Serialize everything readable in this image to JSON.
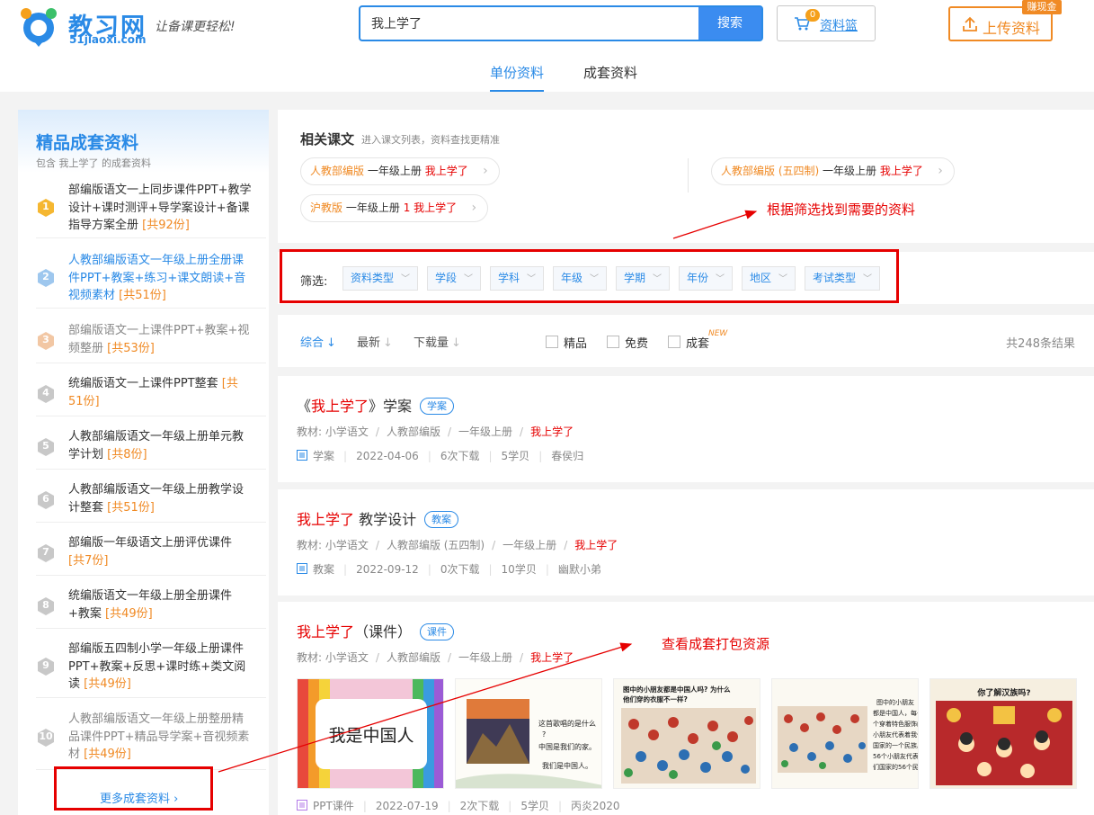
{
  "header": {
    "logo_name": "教习网",
    "logo_domain": "51jiaoxi.com",
    "slogan": "让备课更轻松!",
    "search_value": "我上学了",
    "search_button": "搜索",
    "basket_label": "资料篮",
    "basket_count": "0",
    "upload_label": "上传资料",
    "reward_badge": "赚现金",
    "tabs": [
      "单份资料",
      "成套资料"
    ]
  },
  "sidebar": {
    "title": "精品成套资料",
    "subtitle": "包含 我上学了 的成套资料",
    "items": [
      {
        "num": "1",
        "text": "部编版语文一上同步课件PPT+教学设计+课时测评+导学案设计+备课指导方案全册",
        "count": "[共92份]"
      },
      {
        "num": "2",
        "text": "人教部编版语文一年级上册全册课件PPT+教案+练习+课文朗读+音视频素材",
        "count": "[共51份]"
      },
      {
        "num": "3",
        "text": "部编版语文一上课件PPT+教案+视频整册",
        "count": "[共53份]"
      },
      {
        "num": "4",
        "text": "统编版语文一上课件PPT整套",
        "count": "[共51份]"
      },
      {
        "num": "5",
        "text": "人教部编版语文一年级上册单元教学计划",
        "count": "[共8份]"
      },
      {
        "num": "6",
        "text": "人教部编版语文一年级上册教学设计整套",
        "count": "[共51份]"
      },
      {
        "num": "7",
        "text": "部编版一年级语文上册评优课件",
        "count": "[共7份]"
      },
      {
        "num": "8",
        "text": "统编版语文一年级上册全册课件+教案",
        "count": "[共49份]"
      },
      {
        "num": "9",
        "text": "部编版五四制小学一年级上册课件PPT+教案+反思+课时练+类文阅读",
        "count": "[共49份]"
      },
      {
        "num": "10",
        "text": "人教部编版语文一年级上册整册精品课件PPT+精品导学案+音视频素材",
        "count": "[共49份]"
      }
    ],
    "more_label": "更多成套资料 ›"
  },
  "related": {
    "title": "相关课文",
    "subtitle": "进入课文列表，资料查找更精准",
    "chips": [
      {
        "edition": "人教部编版",
        "grade": "一年级上册",
        "lesson": "我上学了"
      },
      {
        "edition": "人教部编版 (五四制)",
        "grade": "一年级上册",
        "lesson": "我上学了"
      },
      {
        "edition": "沪教版",
        "grade": "一年级上册",
        "lesson": "1 我上学了"
      }
    ],
    "annotation": "根据筛选找到需要的资料"
  },
  "filter": {
    "label": "筛选:",
    "options": [
      "资料类型",
      "学段",
      "学科",
      "年级",
      "学期",
      "年份",
      "地区",
      "考试类型"
    ]
  },
  "sortbar": {
    "sorts": [
      "综合",
      "最新",
      "下载量"
    ],
    "checks": [
      "精品",
      "免费",
      "成套"
    ],
    "new_badge": "NEW",
    "total": "共248条结果"
  },
  "results": [
    {
      "title_pre": "《",
      "title_red": "我上学了",
      "title_post": "》学案",
      "tag": "学案",
      "crumb": [
        "教材:",
        "小学语文",
        "人教部编版",
        "一年级上册",
        "我上学了"
      ],
      "meta": [
        "学案",
        "2022-04-06",
        "6次下载",
        "5学贝",
        "春侯归"
      ]
    },
    {
      "title_pre": "",
      "title_red": "我上学了",
      "title_post": " 教学设计",
      "tag": "教案",
      "crumb": [
        "教材:",
        "小学语文",
        "人教部编版 (五四制)",
        "一年级上册",
        "我上学了"
      ],
      "meta": [
        "教案",
        "2022-09-12",
        "0次下载",
        "10学贝",
        "幽默小弟"
      ]
    },
    {
      "title_pre": "",
      "title_red": "我上学了",
      "title_post": "（课件）",
      "tag": "课件",
      "crumb": [
        "教材:",
        "小学语文",
        "人教部编版",
        "一年级上册",
        "我上学了"
      ],
      "meta": [
        "PPT课件",
        "2022-07-19",
        "2次下载",
        "5学贝",
        "丙炎2020"
      ],
      "annotation": "查看成套打包资源",
      "thumbs": [
        {
          "text": "我是中国人"
        },
        {
          "lines": [
            "这首歌唱的是什么",
            "?",
            "中国是我们的家。",
            "我们是中国人。"
          ]
        },
        {
          "lines": [
            "图中的小朋友都是中国人吗? 为什么",
            "他们穿的衣服不一样?"
          ]
        },
        {
          "lines": [
            "图中的小朋友",
            "都是中国人，每一",
            "个穿着特色服饰的",
            "小朋友代表着我们",
            "国家的一个民族。",
            "56个小朋友代表着我",
            "们国家的56个民族。"
          ]
        },
        {
          "lines": [
            "你了解汉族吗?"
          ]
        }
      ]
    }
  ],
  "colors": {
    "brand": "#2a8ae6",
    "accent": "#f08a24",
    "highlight": "#e60000"
  }
}
